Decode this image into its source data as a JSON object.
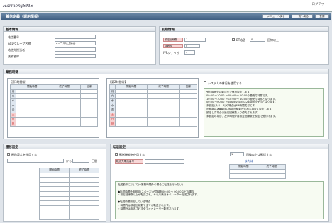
{
  "header": {
    "logo": "HarmonySMS",
    "logout": "ログアウト"
  },
  "title": "着信定義（運用情報）",
  "toolbar": {
    "back": "メニューへ戻る",
    "list": "一覧へ戻る",
    "register": "登録"
  },
  "basic": {
    "title": "基本情報",
    "phone": "着信番号",
    "acd": "ACDグループ名称",
    "acd_value": "2コール以上応答",
    "owner": "着信先担当者",
    "business": "業務名称"
  },
  "initial": {
    "title": "初期情報",
    "threshold": "設定回線数",
    "threshold_value": "1",
    "waiting": "待着呼",
    "waiting_value": "0",
    "ivr": "IVRシナリオ",
    "ivr_value": "-",
    "bt": "BT応答",
    "bt_value": "0",
    "bt_suffix": "回線以上"
  },
  "business_hours": {
    "title": "業務時間",
    "set_a": "【第1時間帯】",
    "set_b": "【第2時間帯】",
    "headers": [
      "開始時間",
      "終了時間",
      "回線"
    ],
    "days": [
      "月",
      "火",
      "水",
      "木",
      "金",
      "土",
      "日",
      "祝"
    ],
    "system_holiday": "システムの休日を使用する",
    "note": "受付時間外は転送先で休日設定します。\n09:00 ～10:00 → 09:00 ～ 10:00の間受付時間です。\n10:00 ～10:00 → 10:00 ～ 10:00の間受付時間となります。\n00:00 ～00:00 → 同時刻の場合は24時間の受付となります。\n未設定(スペース)の場合は24時間受付です。\n回線数は2種類目に設定回線数が変わる場合に設定します。\n設定した場合は設定回線数より優先されます。\n未設定の場合、及び時間外は設定回線数を設定で受付けます。"
  },
  "transfer": {
    "title": "遷移設定",
    "use": "遷移設定を使用する",
    "range_mid": "から",
    "range_suffix": "日間",
    "headers": [
      "開始時間",
      "終了時間"
    ]
  },
  "forward": {
    "title": "転送設定",
    "use": "転送機能を使用する",
    "dest": "転送先電話番号",
    "count_value": "1",
    "count_suffix": "回線以上は転送する",
    "or": "または",
    "headers": [
      "開始時間",
      "終了時間"
    ],
    "note": "転送動作について(※業務時間外の場合に転送を行わない)\n\n●転送時間外未設定(スペース)が同時刻00:00 ～ 00:00などの場合\n・設定回線数以上が転送され、それ未満はオペレーター転送されます。\n\n●転送時間設定している場合\n・時間内は設定回線数で全てが転送されます。\n・時間外は転送されず全てオペレーター転送されます。"
  }
}
